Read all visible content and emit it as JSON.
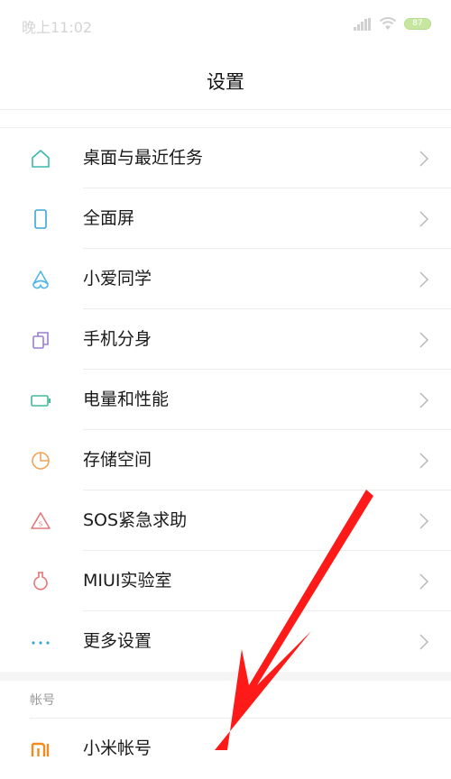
{
  "status_bar": {
    "time": "晚上11:02",
    "battery": "87"
  },
  "header": {
    "title": "设置"
  },
  "settings_items": [
    {
      "label": "桌面与最近任务",
      "icon": "home-icon",
      "color": "#3cb8a8"
    },
    {
      "label": "全面屏",
      "icon": "phone-icon",
      "color": "#3aa7d6"
    },
    {
      "label": "小爱同学",
      "icon": "xiaoai-icon",
      "color": "#4fb6e8"
    },
    {
      "label": "手机分身",
      "icon": "clone-icon",
      "color": "#9b7fd1"
    },
    {
      "label": "电量和性能",
      "icon": "battery-icon",
      "color": "#42b99b"
    },
    {
      "label": "存储空间",
      "icon": "pie-chart-icon",
      "color": "#f0a45a"
    },
    {
      "label": "SOS紧急求助",
      "icon": "sos-icon",
      "color": "#e2787c"
    },
    {
      "label": "MIUI实验室",
      "icon": "flask-icon",
      "color": "#e57878"
    },
    {
      "label": "更多设置",
      "icon": "more-icon",
      "color": "#3aa7d6"
    }
  ],
  "account_section": {
    "header": "帐号",
    "item_label": "小米帐号",
    "item_icon": "mi-logo-icon",
    "item_color": "#f58b1f"
  },
  "annotation": {
    "arrow_color": "#ff1a1a"
  }
}
